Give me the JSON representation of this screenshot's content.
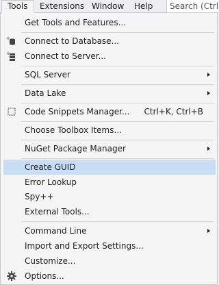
{
  "menubar": {
    "items": [
      {
        "label": "Tools"
      },
      {
        "label": "Extensions"
      },
      {
        "label": "Window"
      },
      {
        "label": "Help"
      }
    ],
    "search_text": "Search (Ctrl+Q)"
  },
  "tools_menu": {
    "items": [
      {
        "label": "Get Tools and Features...",
        "icon": null
      },
      {
        "label": "Connect to Database...",
        "icon": "database-plus-icon"
      },
      {
        "label": "Connect to Server...",
        "icon": "server-plus-icon"
      },
      {
        "label": "SQL Server",
        "submenu": true
      },
      {
        "label": "Data Lake",
        "submenu": true
      },
      {
        "label": "Code Snippets Manager...",
        "shortcut": "Ctrl+K, Ctrl+B",
        "icon": "snippet-icon"
      },
      {
        "label": "Choose Toolbox Items..."
      },
      {
        "label": "NuGet Package Manager",
        "submenu": true
      },
      {
        "label": "Create GUID",
        "highlighted": true
      },
      {
        "label": "Error Lookup"
      },
      {
        "label": "Spy++"
      },
      {
        "label": "External Tools..."
      },
      {
        "label": "Command Line",
        "submenu": true
      },
      {
        "label": "Import and Export Settings..."
      },
      {
        "label": "Customize..."
      },
      {
        "label": "Options...",
        "icon": "gear-icon"
      }
    ]
  },
  "colors": {
    "highlight": "#c9def5",
    "menu_background": "#f5f5f5",
    "icon_green": "#388a34"
  }
}
